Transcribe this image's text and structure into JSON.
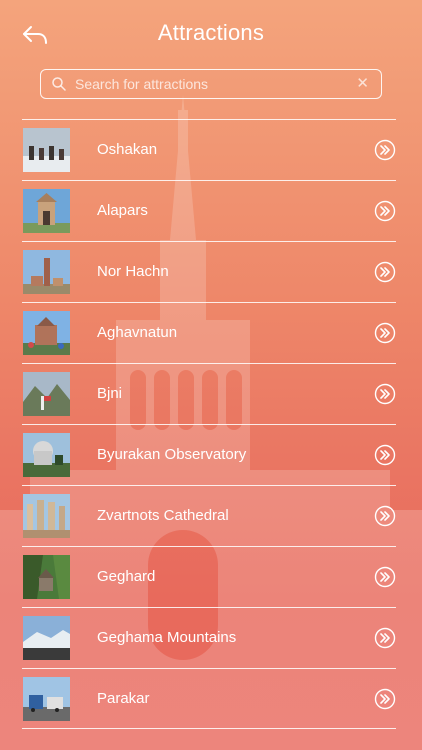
{
  "header": {
    "title": "Attractions",
    "back_icon": "back-arrow-icon"
  },
  "search": {
    "placeholder": "Search for attractions",
    "value": "",
    "icon": "search-icon",
    "clear_icon": "clear-icon"
  },
  "attractions": [
    {
      "name": "Oshakan",
      "thumb": "oshakan-thumbnail"
    },
    {
      "name": "Alapars",
      "thumb": "alapars-thumbnail"
    },
    {
      "name": "Nor Hachn",
      "thumb": "nor-hachn-thumbnail"
    },
    {
      "name": "Aghavnatun",
      "thumb": "aghavnatun-thumbnail"
    },
    {
      "name": "Bjni",
      "thumb": "bjni-thumbnail"
    },
    {
      "name": "Byurakan Observatory",
      "thumb": "byurakan-observatory-thumbnail"
    },
    {
      "name": "Zvartnots Cathedral",
      "thumb": "zvartnots-cathedral-thumbnail"
    },
    {
      "name": "Geghard",
      "thumb": "geghard-thumbnail"
    },
    {
      "name": "Geghama Mountains",
      "thumb": "geghama-mountains-thumbnail"
    },
    {
      "name": "Parakar",
      "thumb": "parakar-thumbnail"
    }
  ],
  "colors": {
    "gradient_top": "#f4a47c",
    "gradient_bottom": "#e8695c",
    "foreground": "#ffffff"
  }
}
